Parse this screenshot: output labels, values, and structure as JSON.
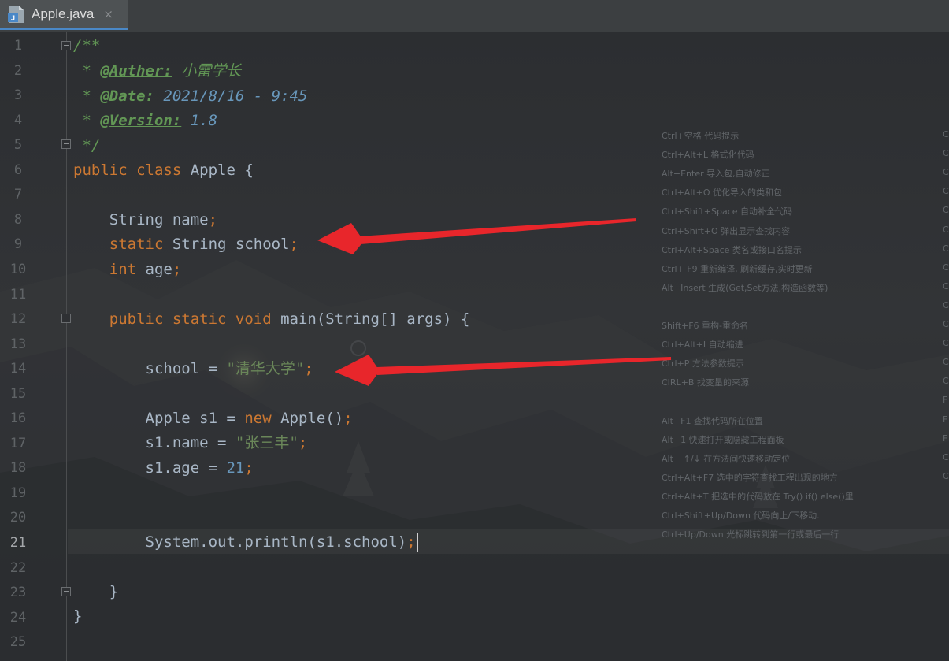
{
  "tab": {
    "file_name": "Apple.java",
    "close_glyph": "×",
    "icon": "java-file-icon"
  },
  "editor": {
    "current_line": 21,
    "line_numbers": [
      "1",
      "2",
      "3",
      "4",
      "5",
      "6",
      "7",
      "8",
      "9",
      "10",
      "11",
      "12",
      "13",
      "14",
      "15",
      "16",
      "17",
      "18",
      "19",
      "20",
      "21",
      "22",
      "23",
      "24",
      "25"
    ],
    "lines": {
      "l1": "/**",
      "l2_star": " * ",
      "l2_tag": "@Auther:",
      "l2_val": " 小雷学长",
      "l3_star": " * ",
      "l3_tag": "@Date:",
      "l3_val": " 2021/8/16 - 9:45",
      "l4_star": " * ",
      "l4_tag": "@Version:",
      "l4_val": " 1.8",
      "l5": " */",
      "l6_kw": "public class",
      "l6_rest": " Apple {",
      "l8_type": "    String name",
      "l8_semi": ";",
      "l9_kw": "    static",
      "l9_rest": " String school",
      "l9_semi": ";",
      "l10_kw": "    int",
      "l10_rest": " age",
      "l10_semi": ";",
      "l12_kw": "    public static void",
      "l12_rest": " main(String[] args) {",
      "l14_a": "        school = ",
      "l14_str": "\"清华大学\"",
      "l14_semi": ";",
      "l16_a": "        Apple s1 = ",
      "l16_kw": "new",
      "l16_b": " Apple()",
      "l16_semi": ";",
      "l17_a": "        s1.name = ",
      "l17_str": "\"张三丰\"",
      "l17_semi": ";",
      "l18_a": "        s1.age = ",
      "l18_num": "21",
      "l18_semi": ";",
      "l21_a": "        System.out.println(s1.school)",
      "l21_semi": ";",
      "l23": "    }",
      "l24": "}"
    }
  },
  "background_tips": [
    "Ctrl+空格  代码提示",
    "Ctrl+Alt+L  格式化代码",
    "Alt+Enter 导入包,自动修正",
    "Ctrl+Alt+O  优化导入的类和包",
    "Ctrl+Shift+Space 自动补全代码",
    "Ctrl+Shift+O  弹出显示查找内容",
    "Ctrl+Alt+Space  类名或接口名提示",
    " Ctrl+ F9 重新编译, 刷新缓存,实时更新",
    "Alt+Insert  生成(Get,Set方法,构造函数等)",
    "",
    "Shift+F6  重构-重命名",
    "Ctrl+Alt+I  自动缩进",
    "Ctrl+P  方法参数提示",
    "CIRL+B  找变量的来源",
    "",
    "Alt+F1 查找代码所在位置",
    "Alt+1 快速打开或隐藏工程面板",
    "Alt+ ↑/↓ 在方法间快速移动定位",
    "Ctrl+Alt+F7  选中的字符查找工程出现的地方",
    "Ctrl+Alt+T  把选中的代码放在 Try() if() else()里",
    "Ctrl+Shift+Up/Down 代码向上/下移动.",
    "Ctrl+Up/Down  光标跳转到第一行或最后一行"
  ],
  "background_tips_right": [
    "C",
    "C",
    "C",
    "C",
    "C",
    "C",
    "C",
    "C",
    "C",
    "C",
    "C",
    "C",
    "C",
    "C",
    "F",
    "F",
    "F",
    "C",
    "C"
  ],
  "colors": {
    "keyword": "#cc7832",
    "string": "#6a8759",
    "number": "#6897bb",
    "doc_comment": "#629755",
    "arrow": "#e8262b"
  }
}
